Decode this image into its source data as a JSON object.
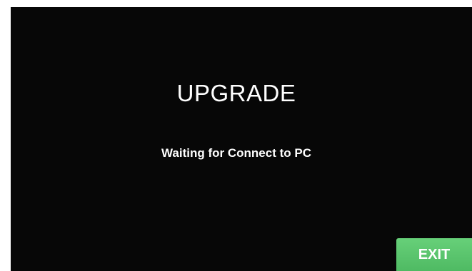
{
  "screen": {
    "title": "UPGRADE",
    "status_text": "Waiting for Connect to PC"
  },
  "exit_button": {
    "label": "EXIT",
    "color": "#5cc46e"
  }
}
